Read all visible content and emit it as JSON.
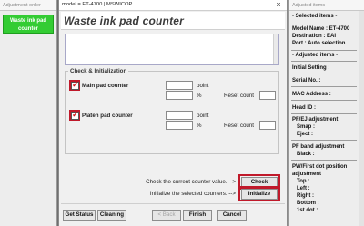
{
  "left_panel": {
    "title": "Adjustment order",
    "items": [
      {
        "label_line1": "Waste ink pad",
        "label_line2": "counter"
      }
    ]
  },
  "window": {
    "title": "model = ET-4700 | MSWICOP",
    "close_glyph": "×",
    "heading": "Waste ink pad counter"
  },
  "check_group": {
    "title": "Check & Initialization",
    "main_pad": {
      "label": "Main pad counter",
      "checked": true,
      "point_value": "",
      "percent_value": "",
      "reset_count_value": "",
      "point_unit": "point",
      "percent_unit": "%",
      "reset_label": "Reset count"
    },
    "platen_pad": {
      "label": "Platen pad counter",
      "checked": true,
      "point_value": "",
      "percent_value": "",
      "reset_count_value": "",
      "point_unit": "point",
      "percent_unit": "%",
      "reset_label": "Reset count"
    }
  },
  "actions": {
    "check_text": "Check the current counter value.  -->",
    "check_button": "Check",
    "init_text": "Initialize the selected counters.  -->",
    "init_button": "Initialize"
  },
  "footer": {
    "get_status": "Get Status",
    "cleaning": "Cleaning",
    "back": "< Back",
    "finish": "Finish",
    "cancel": "Cancel"
  },
  "right_panel": {
    "title": "Adjusted items",
    "selected_items_header": "- Selected items -",
    "model_name": "Model Name : ET-4700",
    "destination": "Destination : EAI",
    "port": "Port : Auto selection",
    "adjusted_items_header": "- Adjusted items -",
    "initial_setting": "Initial Setting :",
    "serial_no": "Serial No. :",
    "mac_address": "MAC Address :",
    "head_id": "Head ID :",
    "pf_ej": "PF/EJ adjustment",
    "smap": "Smap :",
    "eject": "Eject :",
    "pf_band": "PF band adjustment",
    "black": "Black :",
    "pw_first_dot": "PW/First dot position",
    "adjustment": "adjustment",
    "top": "Top :",
    "left": "Left :",
    "right": "Right :",
    "bottom": "Bottom :",
    "first_dot": "1st dot :"
  },
  "colors": {
    "left_item_bg": "#33cc33",
    "highlight_red": "#c0192a",
    "checkmark_red": "#d01818"
  }
}
